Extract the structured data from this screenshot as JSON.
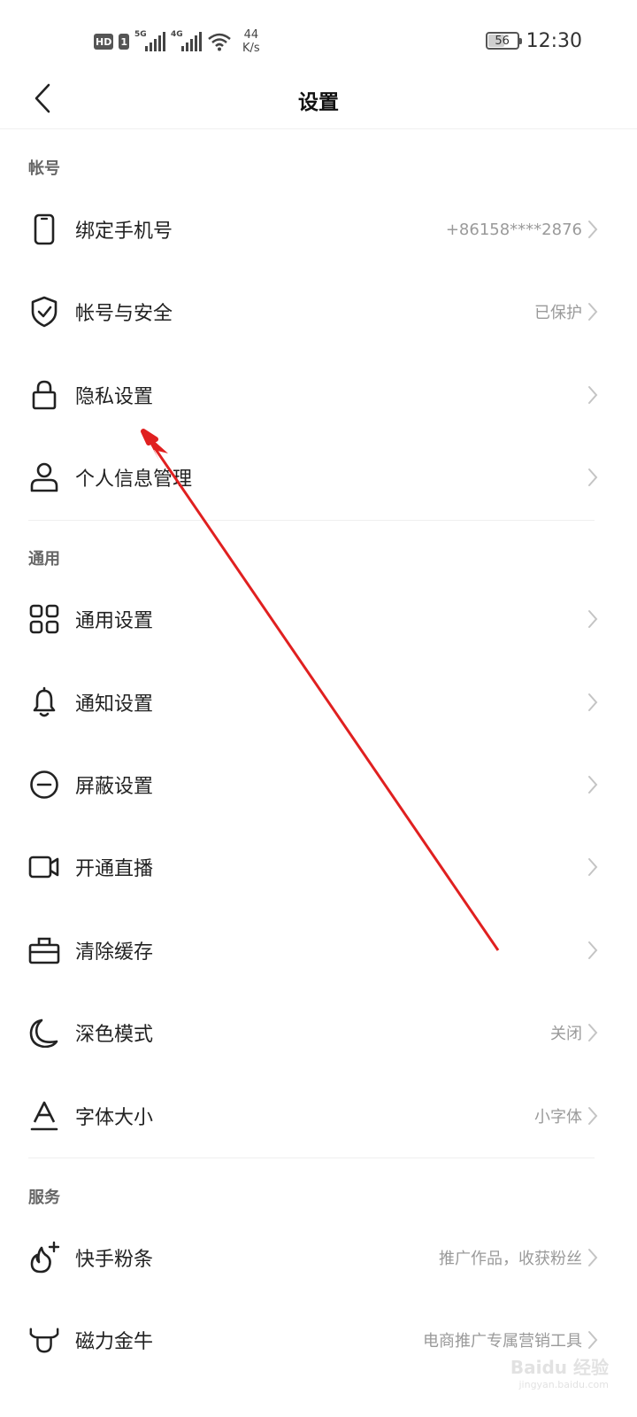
{
  "status_bar": {
    "hd_badge": "HD",
    "sim_badge": "1",
    "signal1_tag": "5G",
    "signal2_tag": "4G",
    "speed_value": "44",
    "speed_unit": "K/s",
    "battery": "56",
    "time": "12:30"
  },
  "header": {
    "title": "设置",
    "back_icon": "chevron-left-icon"
  },
  "sections": {
    "account": {
      "title": "帐号",
      "items": [
        {
          "label": "绑定手机号",
          "value": "+86158****2876",
          "icon": "phone-icon"
        },
        {
          "label": "帐号与安全",
          "value": "已保护",
          "icon": "shield-check-icon"
        },
        {
          "label": "隐私设置",
          "value": "",
          "icon": "lock-icon"
        },
        {
          "label": "个人信息管理",
          "value": "",
          "icon": "person-icon"
        }
      ]
    },
    "general": {
      "title": "通用",
      "items": [
        {
          "label": "通用设置",
          "value": "",
          "icon": "grid-icon"
        },
        {
          "label": "通知设置",
          "value": "",
          "icon": "bell-icon"
        },
        {
          "label": "屏蔽设置",
          "value": "",
          "icon": "block-icon"
        },
        {
          "label": "开通直播",
          "value": "",
          "icon": "video-camera-icon"
        },
        {
          "label": "清除缓存",
          "value": "",
          "icon": "toolbox-icon"
        },
        {
          "label": "深色模式",
          "value": "关闭",
          "icon": "moon-icon"
        },
        {
          "label": "字体大小",
          "value": "小字体",
          "icon": "font-size-icon"
        }
      ]
    },
    "services": {
      "title": "服务",
      "items": [
        {
          "label": "快手粉条",
          "value": "推广作品，收获粉丝",
          "icon": "flame-plus-icon"
        },
        {
          "label": "磁力金牛",
          "value": "电商推广专属营销工具",
          "icon": "bull-icon"
        }
      ]
    }
  },
  "watermark": {
    "main": "Baidu 经验",
    "sub": "jingyan.baidu.com"
  },
  "colors": {
    "annotation_arrow": "#e02020",
    "secondary_text": "#9a9a9a"
  }
}
